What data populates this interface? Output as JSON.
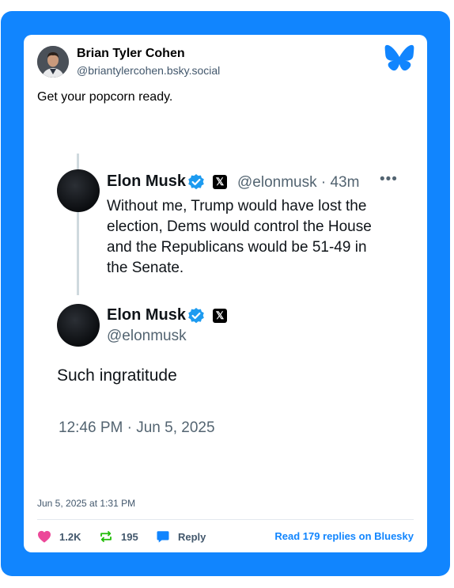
{
  "post": {
    "author_name": "Brian Tyler Cohen",
    "author_handle": "@briantylercohen.bsky.social",
    "text": "Get your popcorn ready.",
    "date": "Jun 5, 2025 at 1:31 PM"
  },
  "embedded_tweets": {
    "first": {
      "name": "Elon Musk",
      "x_badge": "𝕏",
      "meta": "@elonmusk · 43m",
      "more": "•••",
      "lines": [
        "Without me, Trump would have lost the",
        "election, Dems would control the House",
        "and the Republicans would be 51-49 in",
        "the Senate."
      ]
    },
    "second": {
      "name": "Elon Musk",
      "x_badge": "𝕏",
      "handle": "@elonmusk",
      "text": "Such ingratitude",
      "timestamp": "12:46 PM · Jun 5, 2025"
    }
  },
  "actions": {
    "likes": "1.2K",
    "reposts": "195",
    "reply_label": "Reply",
    "read_replies": "Read 179 replies on Bluesky"
  },
  "colors": {
    "frame_blue": "#1185fe",
    "like_pink": "#ec4899",
    "repost_green": "#20bc07",
    "verified_blue": "#1d9bf0"
  },
  "icons": [
    "avatar",
    "bluesky-butterfly-icon",
    "verified-badge-icon",
    "x-logo-icon",
    "heart-icon",
    "repost-icon",
    "reply-bubble-icon"
  ]
}
